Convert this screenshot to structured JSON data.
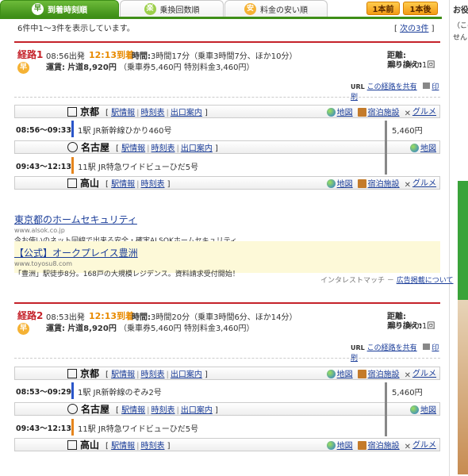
{
  "tabs": [
    {
      "icon": "早",
      "label": "到着時刻順",
      "active": true
    },
    {
      "icon": "楽",
      "label": "乗換回数順",
      "active": false
    },
    {
      "icon": "安",
      "label": "料金の安い順",
      "active": false
    }
  ],
  "nav": {
    "prev": "1本前",
    "next": "1本後"
  },
  "summary": {
    "text": "6件中1～3件を表示しています。",
    "next_link": "次の3件"
  },
  "routes": [
    {
      "label": "経路1",
      "depart": "08:56出発",
      "arrive": "12:13到着",
      "time_label": "時間:",
      "time": "3時間17分（乗車3時間7分、ほか10分）",
      "fare_label": "運賃:",
      "fare": "片道8,920円",
      "fare_detail": "（乗車券5,460円 特別料金3,460円）",
      "distance_label": "距離:",
      "distance": "314.3km",
      "transfers_label": "乗り換え:",
      "transfers": "1回",
      "badge": "早",
      "share": "この経路を共有",
      "print": "印刷",
      "url_label": "URL",
      "stations": [
        {
          "name": "京都",
          "links": [
            "駅情報",
            "時刻表",
            "出口案内"
          ],
          "icons": [
            "地図",
            "宿泊施設",
            "グルメ"
          ]
        },
        {
          "name": "名古屋",
          "links": [
            "駅情報",
            "時刻表",
            "出口案内"
          ],
          "icons": [
            "地図"
          ]
        },
        {
          "name": "高山",
          "links": [
            "駅情報",
            "時刻表"
          ],
          "icons": [
            "地図",
            "宿泊施設",
            "グルメ"
          ]
        }
      ],
      "segments": [
        {
          "time": "08:56～09:33",
          "text": "1駅 JR新幹線ひかり460号",
          "fare": "5,460円",
          "color": "#2a55c9"
        },
        {
          "time": "09:43～12:13",
          "text": "11駅 JR特急ワイドビューひだ5号",
          "fare": "",
          "color": "#e5851d"
        }
      ]
    },
    {
      "label": "経路2",
      "depart": "08:53出発",
      "arrive": "12:13到着",
      "time_label": "時間:",
      "time": "3時間20分（乗車3時間6分、ほか14分）",
      "fare_label": "運賃:",
      "fare": "片道8,920円",
      "fare_detail": "（乗車券5,460円 特別料金3,460円）",
      "distance_label": "距離:",
      "distance": "314.3km",
      "transfers_label": "乗り換え:",
      "transfers": "1回",
      "badge": "早",
      "share": "この経路を共有",
      "print": "印刷",
      "url_label": "URL",
      "stations": [
        {
          "name": "京都",
          "links": [
            "駅情報",
            "時刻表",
            "出口案内"
          ],
          "icons": [
            "地図",
            "宿泊施設",
            "グルメ"
          ]
        },
        {
          "name": "名古屋",
          "links": [
            "駅情報",
            "時刻表",
            "出口案内"
          ],
          "icons": [
            "地図"
          ]
        },
        {
          "name": "高山",
          "links": [
            "駅情報",
            "時刻表"
          ],
          "icons": [
            "地図",
            "宿泊施設",
            "グルメ"
          ]
        }
      ],
      "segments": [
        {
          "time": "08:53～09:29",
          "text": "1駅 JR新幹線のぞみ2号",
          "fare": "5,460円",
          "color": "#2a55c9"
        },
        {
          "time": "09:43～12:13",
          "text": "11駅 JR特急ワイドビューひだ5号",
          "fare": "",
          "color": "#e5851d"
        }
      ]
    }
  ],
  "ads": [
    {
      "title": "東京都のホームセキュリティ",
      "url": "www.alsok.co.jp",
      "desc": "今お使いのネット回線で出来る安全・確実ALSOKホームセキュリティ"
    },
    {
      "title": "【公式】オークプレイス豊洲",
      "url": "www.toyosu8.com",
      "desc": "「豊洲」駅徒歩8分。168戸の大規模レジデンス。資料請求受付開始！"
    }
  ],
  "ad_footer": {
    "label": "インタレストマッチ",
    "sep": " － ",
    "link": "広告掲載について"
  },
  "sidebar": {
    "heading": "お役",
    "text1": "（この",
    "text2": "せん"
  },
  "colors": {
    "accent_green": "#3e8e17",
    "route_red": "#c5222a",
    "arrive_orange": "#e88a00",
    "shinkansen_blue": "#2a55c9",
    "limited_orange": "#e5851d",
    "ad_bg": "#fdf9d8"
  }
}
